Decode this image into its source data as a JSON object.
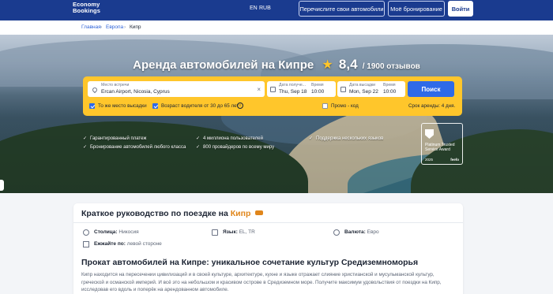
{
  "header": {
    "logo_line1": "Economy",
    "logo_line2": "Bookings",
    "lang_en": "EN",
    "lang_rub": "RUB",
    "list_cars_btn": "Перечислите свои автомобили",
    "my_booking_btn": "Моё бронирование",
    "login_btn": "Войти"
  },
  "breadcrumb": [
    "Главная",
    "Европа",
    "Кипр"
  ],
  "hero": {
    "title": "Аренда автомобилей на Кипре",
    "rating": "8,4",
    "reviews": "/ 1900 отзывов"
  },
  "search": {
    "location_label": "Место встречи",
    "location_value": "Ercan Airport, Nicosia, Cyprus",
    "pickup_date_label": "Дата получе...",
    "pickup_date_value": "Thu, Sep 18",
    "pickup_time_label": "Время",
    "pickup_time_value": "10:00",
    "return_date_label": "Дата высадки",
    "return_date_value": "Mon, Sep 22",
    "return_time_label": "Время",
    "return_time_value": "10:00",
    "search_btn": "Поиск",
    "same_dropoff": "То же место высадки",
    "driver_age": "Возраст водителя от 30 до 65 лет",
    "promo": "Промо - код",
    "rental_term": "Срок аренды: 4 дня."
  },
  "benefits": [
    "Гарантированный платеж",
    "4 миллиона пользователей",
    "Поддержка нескольких языков",
    "Бронирование автомобилей любого класса",
    "800 провайдеров по всему миру"
  ],
  "award": {
    "title": "Platinum Trusted Service Award",
    "year": "2025",
    "brand": "feefo"
  },
  "guide": {
    "title_prefix": "Краткое руководство по поездке на ",
    "title_country": "Кипр",
    "capital_key": "Столица:",
    "capital_val": "Никосия",
    "lang_key": "Язык:",
    "lang_val": "EL, TR",
    "currency_key": "Валюта:",
    "currency_val": "Евро",
    "drive_key": "Ежжайте по:",
    "drive_val": "левой стороне",
    "section_title": "Прокат автомобилей на Кипре: уникальное сочетание культур Средиземноморья",
    "paragraph": "Кипр находится на пересечении цивилизаций и в своей культуре, архитектуре, кухне и языке отражает слияние христианской и мусульманской культур, греческой и османской империй. И всё это на небольшом и красивом острове в Средиземном море. Получите максимум удовольствия от поездки на Кипр, исследовав его вдоль и поперёк на арендованном автомобиле."
  },
  "colors": {
    "header_bg": "#1a3b8f",
    "search_box": "#ffc62b",
    "search_btn": "#2f6ae8",
    "accent_orange": "#e0861b",
    "link": "#2f63d8"
  }
}
